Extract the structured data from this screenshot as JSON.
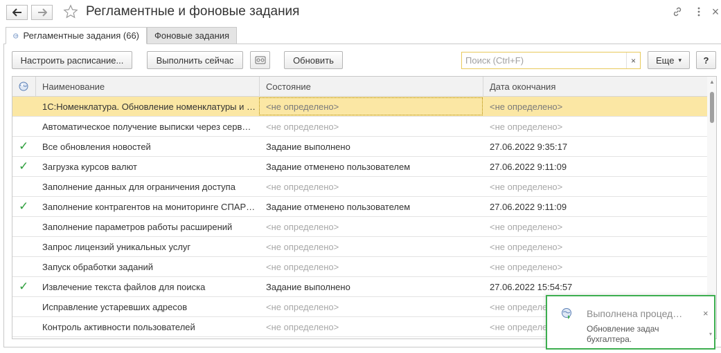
{
  "window": {
    "title": "Регламентные и фоновые задания",
    "back_icon": "arrow-left-icon",
    "forward_icon": "arrow-right-icon",
    "favorite_icon": "star-icon",
    "link_icon": "link-icon",
    "more_icon": "vertical-dots-icon",
    "close_label": "×"
  },
  "tabs": [
    {
      "label": "Регламентные задания (66)",
      "icon": "globe-icon",
      "active": true
    },
    {
      "label": "Фоновые задания",
      "active": false
    }
  ],
  "toolbar": {
    "schedule_label": "Настроить расписание...",
    "run_now_label": "Выполнить сейчас",
    "settings_icon": "tape-icon",
    "refresh_label": "Обновить",
    "search_placeholder": "Поиск (Ctrl+F)",
    "search_value": "",
    "search_clear": "×",
    "more_label": "Еще",
    "more_arrow": "▾",
    "help_label": "?"
  },
  "table": {
    "columns": [
      "",
      "Наименование",
      "Состояние",
      "Дата окончания"
    ],
    "header_icon": "globe-icon",
    "rows": [
      {
        "check": "",
        "name": "1С:Номенклатура. Обновление номенклатуры и …",
        "state": "<не определено>",
        "date": "<не определено>",
        "selected": true
      },
      {
        "check": "",
        "name": "Автоматическое получение выписки через серв…",
        "state": "<не определено>",
        "date": "<не определено>"
      },
      {
        "check": "✓",
        "name": "Все обновления новостей",
        "state": "Задание выполнено",
        "date": "27.06.2022 9:35:17"
      },
      {
        "check": "✓",
        "name": "Загрузка курсов валют",
        "state": "Задание отменено пользователем",
        "date": "27.06.2022 9:11:09"
      },
      {
        "check": "",
        "name": "Заполнение данных для ограничения доступа",
        "state": "<не определено>",
        "date": "<не определено>"
      },
      {
        "check": "✓",
        "name": "Заполнение контрагентов на мониторинге СПАР…",
        "state": "Задание отменено пользователем",
        "date": "27.06.2022 9:11:09"
      },
      {
        "check": "",
        "name": "Заполнение параметров работы расширений",
        "state": "<не определено>",
        "date": "<не определено>"
      },
      {
        "check": "",
        "name": "Запрос лицензий уникальных услуг",
        "state": "<не определено>",
        "date": "<не определено>"
      },
      {
        "check": "",
        "name": "Запуск обработки заданий",
        "state": "<не определено>",
        "date": "<не определено>"
      },
      {
        "check": "✓",
        "name": "Извлечение текста файлов для поиска",
        "state": "Задание выполнено",
        "date": "27.06.2022 15:54:57"
      },
      {
        "check": "",
        "name": "Исправление устаревших адресов",
        "state": "<не определено>",
        "date": "<не определено>"
      },
      {
        "check": "",
        "name": "Контроль активности пользователей",
        "state": "<не определено>",
        "date": "<не определено>"
      },
      {
        "check": "",
        "name": "",
        "state": "",
        "date": ""
      }
    ]
  },
  "notification": {
    "icon": "process-done-icon",
    "title": "Выполнена процед…",
    "text": "Обновление задач бухгалтера.",
    "close_label": "×",
    "more_arrow": "▾"
  },
  "colors": {
    "selected_row": "#fbe7a4",
    "check_green": "#2e9e3c",
    "notify_border": "#3cae4f",
    "search_border": "#e8c95a"
  }
}
